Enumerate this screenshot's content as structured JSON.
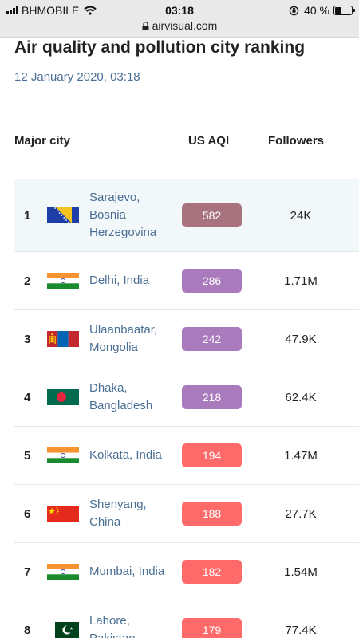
{
  "status_bar": {
    "carrier": "BHMOBILE",
    "time": "03:18",
    "battery_text": "40 %",
    "battery_level": 0.4,
    "url": "airvisual.com",
    "icons": [
      "signal-icon",
      "wifi-icon",
      "rotation-lock-icon",
      "battery-icon",
      "lock-icon"
    ]
  },
  "page": {
    "title": "Air quality and pollution city ranking",
    "date": "12 January 2020, 03:18"
  },
  "table": {
    "headers": {
      "city": "Major city",
      "aqi": "US AQI",
      "followers": "Followers"
    },
    "rows": [
      {
        "rank": "1",
        "flag": "bosnia-herzegovina-flag",
        "city": "Sarajevo, Bosnia Herzegovina",
        "aqi": "582",
        "aqi_color": "#a8737e",
        "followers": "24K"
      },
      {
        "rank": "2",
        "flag": "india-flag",
        "city": "Delhi, India",
        "aqi": "286",
        "aqi_color": "#a97abc",
        "followers": "1.71M"
      },
      {
        "rank": "3",
        "flag": "mongolia-flag",
        "city": "Ulaanbaatar, Mongolia",
        "aqi": "242",
        "aqi_color": "#a97abc",
        "followers": "47.9K"
      },
      {
        "rank": "4",
        "flag": "bangladesh-flag",
        "city": "Dhaka, Bangladesh",
        "aqi": "218",
        "aqi_color": "#a97abc",
        "followers": "62.4K"
      },
      {
        "rank": "5",
        "flag": "india-flag",
        "city": "Kolkata, India",
        "aqi": "194",
        "aqi_color": "#fe6a69",
        "followers": "1.47M"
      },
      {
        "rank": "6",
        "flag": "china-flag",
        "city": "Shenyang, China",
        "aqi": "188",
        "aqi_color": "#fe6a69",
        "followers": "27.7K"
      },
      {
        "rank": "7",
        "flag": "india-flag",
        "city": "Mumbai, India",
        "aqi": "182",
        "aqi_color": "#fe6a69",
        "followers": "1.54M"
      },
      {
        "rank": "8",
        "flag": "pakistan-flag",
        "city": "Lahore, Pakistan",
        "aqi": "179",
        "aqi_color": "#fe6a69",
        "followers": "77.4K"
      }
    ]
  }
}
